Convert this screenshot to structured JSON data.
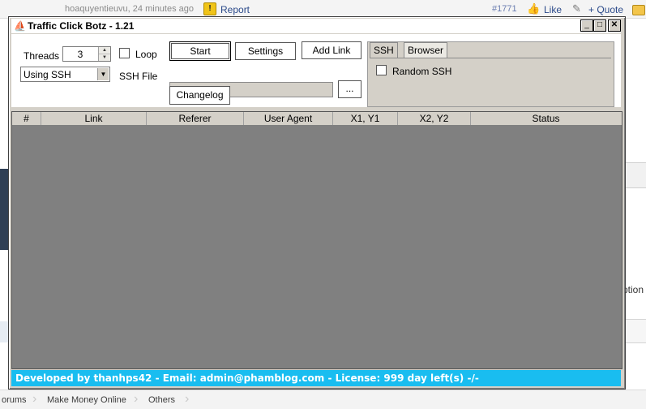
{
  "forum": {
    "post_meta": "hoaquyentieuvu, 24 minutes ago",
    "report": "Report",
    "post_number": "#1771",
    "like": "Like",
    "quote": "+ Quote",
    "right_side_text": "ption",
    "breadcrumbs": [
      "orums",
      "Make Money Online",
      "Others"
    ]
  },
  "window": {
    "title": "Traffic Click Botz - 1.21",
    "threads_label": "Threads",
    "threads_value": "3",
    "loop_label": "Loop",
    "mode_select": "Using SSH",
    "ssh_file_label": "SSH File",
    "browse_label": "...",
    "buttons": {
      "start": "Start",
      "settings": "Settings",
      "add_link": "Add Link",
      "changelog": "Changelog"
    },
    "tabs": [
      "SSH",
      "Browser"
    ],
    "random_ssh_label": "Random SSH",
    "columns": [
      "#",
      "Link",
      "Referer",
      "User Agent",
      "X1, Y1",
      "X2, Y2",
      "Status"
    ],
    "status_text": "Developed by thanhps42 - Email: admin@phamblog.com - License: 999 day left(s) -/-"
  },
  "colors": {
    "status_bar": "#19bdf0",
    "grid_background": "#808080",
    "window_face": "#d4d0c8"
  }
}
